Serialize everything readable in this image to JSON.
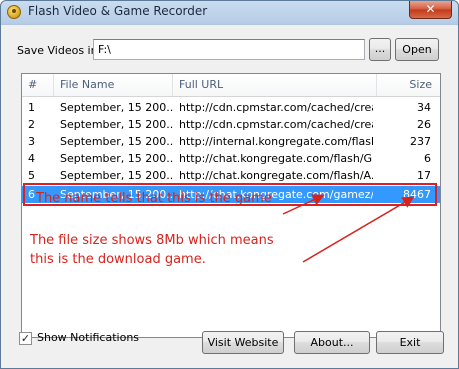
{
  "window": {
    "title": "Flash Video & Game Recorder",
    "close_glyph": "✕"
  },
  "save": {
    "label": "Save Videos in:",
    "path_value": "F:\\",
    "browse_label": "...",
    "open_label": "Open"
  },
  "list": {
    "columns": [
      "#",
      "File Name",
      "Full URL",
      "Size"
    ],
    "rows": [
      {
        "num": "1",
        "name": "September, 15 200...",
        "url": "http://cdn.cpmstar.com/cached/crea...",
        "size": "34"
      },
      {
        "num": "2",
        "name": "September, 15 200...",
        "url": "http://cdn.cpmstar.com/cached/crea...",
        "size": "26"
      },
      {
        "num": "3",
        "name": "September, 15 200...",
        "url": "http://internal.kongregate.com/flash...",
        "size": "237"
      },
      {
        "num": "4",
        "name": "September, 15 200...",
        "url": "http://chat.kongregate.com/flash/G...",
        "size": "6"
      },
      {
        "num": "5",
        "name": "September, 15 200...",
        "url": "http://chat.kongregate.com/flash/A...",
        "size": "17"
      },
      {
        "num": "6",
        "name": "September, 15 200...",
        "url": "http://chat.kongregate.com/gamez/...",
        "size": "8467"
      }
    ],
    "selected_row": 6
  },
  "annotations": {
    "line1": "The name tells that this is the game",
    "line2a": "The file size shows 8Mb which means",
    "line2b": "this is the download game.",
    "color": "#d8221c"
  },
  "footer": {
    "show_notifications_label": "Show Notifications",
    "show_notifications_checked": true,
    "check_glyph": "✓",
    "visit_label": "Visit Website",
    "about_label": "About...",
    "exit_label": "Exit"
  },
  "colors": {
    "selection": "#3399ff",
    "highlight_outline": "#e02020"
  }
}
